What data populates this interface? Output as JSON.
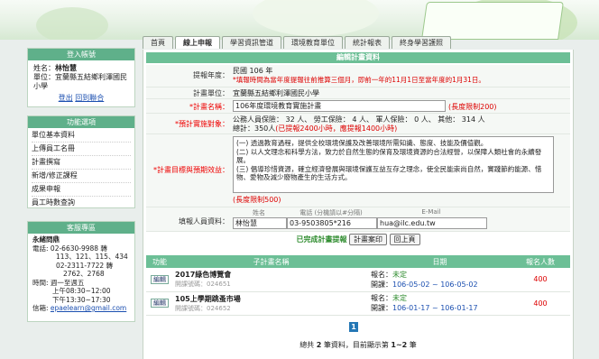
{
  "tabs": [
    "首頁",
    "線上申報",
    "學習資訊管道",
    "環境教育單位",
    "統計報表",
    "終身學習護照"
  ],
  "login": {
    "title": "登入帳號",
    "name_label": "姓名：",
    "name": "林怡慧",
    "unit_label": "單位：",
    "unit": "宜蘭縣五結鄉利澤國民小學",
    "logout": "登出",
    "back": "回到聯合"
  },
  "menu": {
    "title": "功能選項",
    "items": [
      "單位基本資料",
      "上傳員工名冊",
      "計畫撰寫",
      "新增/修正課程",
      "成果申報",
      "員工時數查詢"
    ]
  },
  "contact": {
    "title": "客服專區",
    "org": "永緒問鼎",
    "tel_label": "電話:",
    "tel1": "02-6630-9988 轉",
    "tel1b": "113、121、115、434",
    "tel2": "02-2311-7722 轉",
    "tel2b": "2762、2768",
    "time_label": "時間:",
    "time1": "週一至週五",
    "time2": "上午08:30~12:00",
    "time3": "下午13:30~17:30",
    "mail_label": "信箱:",
    "mail": "epaelearn@gmail.com"
  },
  "form": {
    "header": "編輯計畫資料",
    "year_label": "提報年度：",
    "year": "民國 106 年",
    "year_note": "*填報時間為當年度提報往前推算三個月，即前一年的11月1日至當年度的1月31日。",
    "unit_label": "計畫單位：",
    "unit": "宜蘭縣五結鄉利澤國民小學",
    "name_label": "*計畫名稱：",
    "name": "106年度環境教育實施計畫",
    "name_limit": "(長度限制200)",
    "target_label": "*預計實施對象：",
    "target_line": "公務人員保險： 32 人、 勞工保險： 4 人、 軍人保險： 0 人、 其他： 314 人",
    "hours_total": "總計：350人",
    "hours_note": "(已提報2400小時，應提報1400小時)",
    "goal_label": "*計畫目標與預期效益：",
    "goals": [
      "(一) 透過教育過程，提供全校環境保護及改善環境所需知識、態度、技能及價值觀。",
      "(二) 以人文理念和科學方法，致力於自然生態的保育及環境資源的合法經營，以保障人類社會的永續發展。",
      "(三) 倡導珍惜資源，確立經濟發展與環境保護互益互存之理念，使全民能崇尚自然，實踐節約能源、惜物、愛物及減少廢物產生的生活方式。"
    ],
    "goal_limit": "(長度限制500)",
    "contact_label": "填報人員資料：",
    "col_name": "姓名",
    "col_tel": "電話 (分機請以#分隔)",
    "col_mail": "E-Mail",
    "contact_name": "林怡慧",
    "contact_tel": "03-9503805*216",
    "contact_mail": "hua@ilc.edu.tw",
    "done_msg": "已完成計畫提報",
    "save_btn": "計畫案印",
    "back_btn": "回上頁"
  },
  "table": {
    "headers": [
      "功能",
      "子計畫名稱",
      "日期",
      "報名人數"
    ],
    "rows": [
      {
        "edit": "編輯",
        "title": "2017綠色博覽會",
        "id_label": "開課號碼：",
        "id": "024651",
        "status_label": "報名：",
        "status": "未定",
        "date_label": "開課：",
        "date": "106-05-02 ~ 106-05-02",
        "count": "400"
      },
      {
        "edit": "編輯",
        "title": "105上學期跳蚤市場",
        "id_label": "開課號碼：",
        "id": "024652",
        "status_label": "報名：",
        "status": "未定",
        "date_label": "開課：",
        "date": "106-01-17 ~ 106-01-17",
        "count": "400"
      }
    ]
  },
  "pager": {
    "page": "1",
    "summary_pre": "總共",
    "total": "2",
    "summary_mid": "筆資料，目前顯示第",
    "range": "1~2",
    "summary_post": "筆"
  }
}
